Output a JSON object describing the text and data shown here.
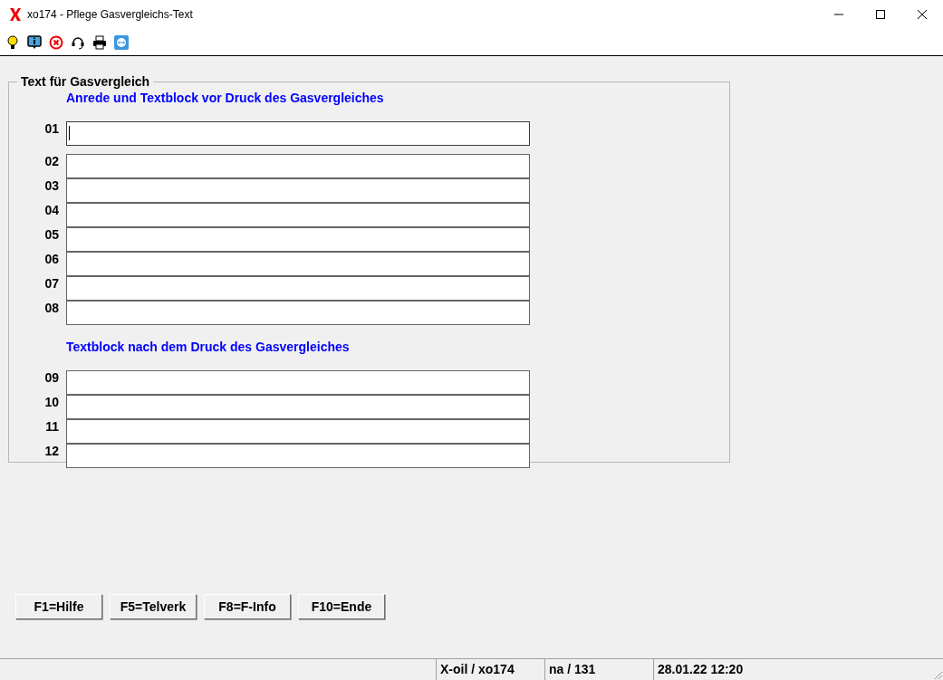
{
  "window": {
    "title": "xo174 - Pflege Gasvergleichs-Text"
  },
  "group": {
    "title": "Text für Gasvergleich",
    "sections": [
      {
        "heading": "Anrede und Textblock vor Druck des Gasvergleiches",
        "blocks": [
          {
            "fields": [
              {
                "label": "01",
                "focused": true
              }
            ]
          },
          {
            "fields": [
              {
                "label": "02",
                "focused": false
              },
              {
                "label": "03",
                "focused": false
              },
              {
                "label": "04",
                "focused": false
              },
              {
                "label": "05",
                "focused": false
              },
              {
                "label": "06",
                "focused": false
              },
              {
                "label": "07",
                "focused": false
              },
              {
                "label": "08",
                "focused": false
              }
            ]
          }
        ]
      },
      {
        "heading": "Textblock nach dem Druck des Gasvergleiches",
        "blocks": [
          {
            "fields": [
              {
                "label": "09",
                "focused": false
              },
              {
                "label": "10",
                "focused": false
              },
              {
                "label": "11",
                "focused": false
              },
              {
                "label": "12",
                "focused": false
              }
            ]
          }
        ]
      }
    ]
  },
  "buttons": [
    "F1=Hilfe",
    "F5=Telverk",
    "F8=F-Info",
    "F10=Ende"
  ],
  "status_bar": [
    "X-oil / xo174",
    "na / 131",
    "28.01.22 12:20"
  ]
}
